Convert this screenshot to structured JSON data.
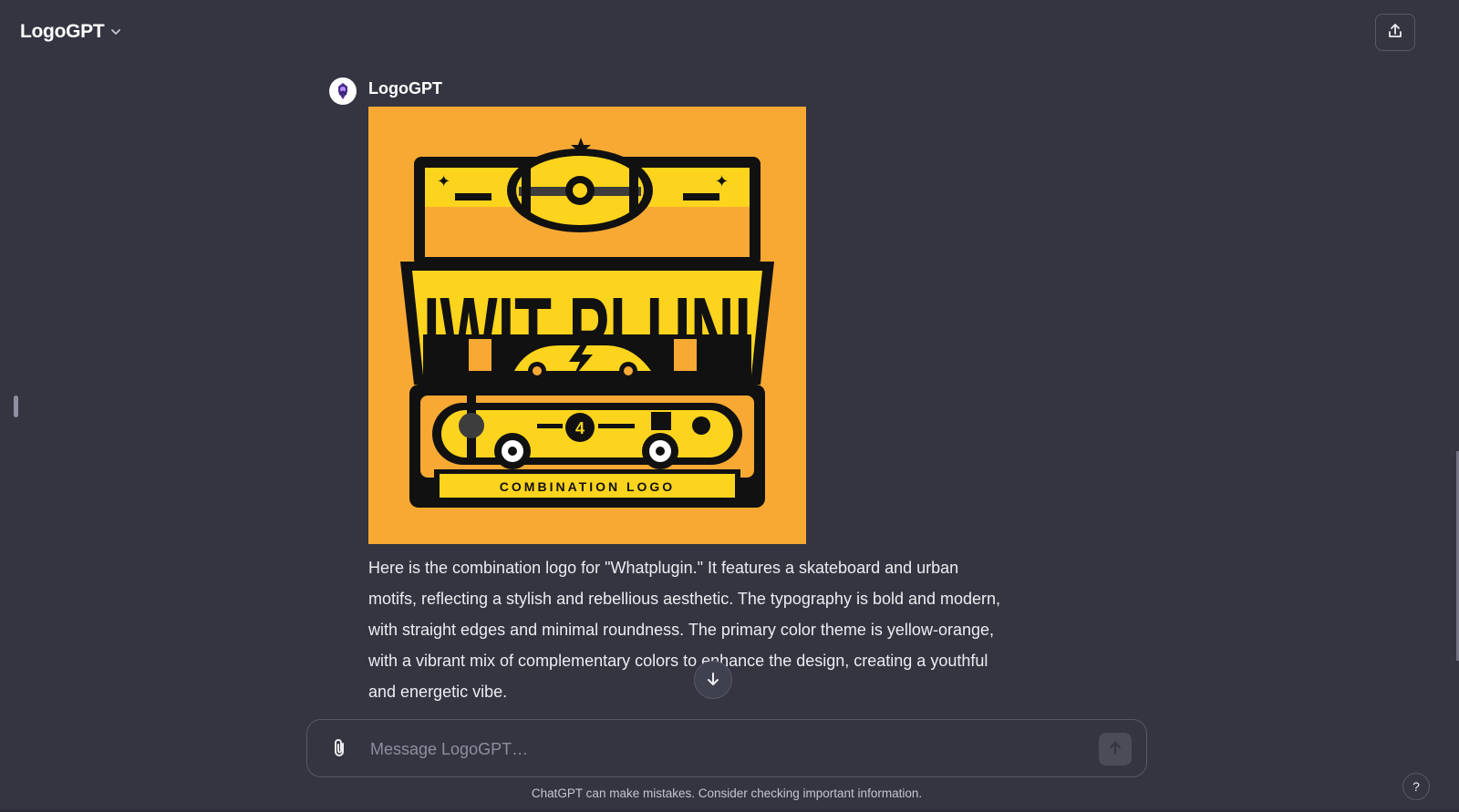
{
  "header": {
    "model_name": "LogoGPT",
    "share_icon": "share-upload-icon",
    "chevron_icon": "chevron-down-icon"
  },
  "message": {
    "author": "LogoGPT",
    "image": {
      "headline": "IWIT PLUNI",
      "badge_char": "4",
      "banner_text": "COMBINATION LOGO",
      "background_color": "#f7a934"
    },
    "text": "Here is the combination logo for \"Whatplugin.\" It features a skateboard and urban motifs, reflecting a stylish and rebellious aesthetic. The typography is bold and modern, with straight edges and minimal roundness. The primary color theme is yellow-orange, with a vibrant mix of complementary colors to enhance the design, creating a youthful and energetic vibe."
  },
  "composer": {
    "placeholder": "Message LogoGPT…",
    "attach_icon": "paperclip-icon",
    "send_icon": "arrow-up-icon"
  },
  "scroll_down_icon": "arrow-down-icon",
  "disclaimer": "ChatGPT can make mistakes. Consider checking important information.",
  "help_label": "?",
  "colors": {
    "background": "#343541",
    "border": "#565869",
    "text": "#ececf1",
    "accent_orange": "#f7a934",
    "accent_yellow": "#fcd41d"
  }
}
